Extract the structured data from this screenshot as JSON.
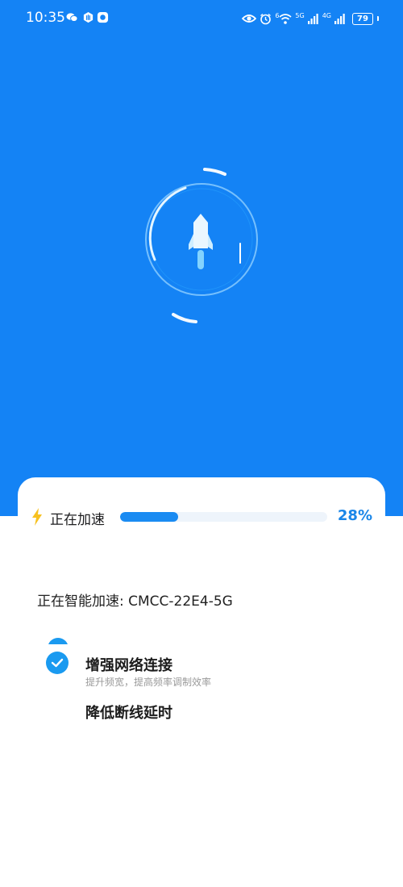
{
  "status_bar": {
    "time": "10:35",
    "left_icons": [
      "wechat-icon",
      "hand-icon",
      "app-icon"
    ],
    "right_icons": [
      "eye-icon",
      "alarm-icon",
      "wifi-icon",
      "signal-icon",
      "signal-icon"
    ],
    "wifi_badge": "6",
    "network_5g": "5G",
    "network_4g": "4G",
    "battery": "79"
  },
  "hero": {
    "background_color": "#1483f5",
    "icon": "rocket-icon"
  },
  "progress": {
    "icon": "lightning-icon",
    "label": "正在加速",
    "percent_text": "28%",
    "value": 0.28,
    "accent": "#1a8bf2"
  },
  "network": {
    "text": "正在智能加速: CMCC-22E4-5G"
  },
  "tasks": [
    {
      "title": "增强网络连接",
      "description": "提升频宽，提高频率调制效率",
      "icon": "check-icon"
    },
    {
      "title": "降低断线延时"
    }
  ]
}
